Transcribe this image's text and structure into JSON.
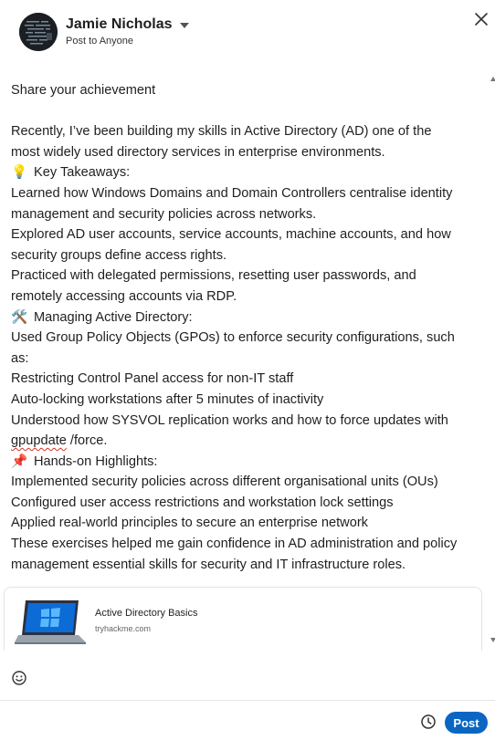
{
  "author": {
    "name": "Jamie Nicholas",
    "audience": "Post to Anyone"
  },
  "editor": {
    "lines": [
      {
        "text": "Share your achievement"
      },
      {
        "text": "",
        "blank": true
      },
      {
        "text": "Recently, I’ve been building my skills in Active Directory (AD) one of the"
      },
      {
        "text": "most widely used directory services in enterprise environments."
      },
      {
        "emoji": "💡",
        "text": "Key Takeaways:"
      },
      {
        "text": "Learned how Windows Domains and Domain Controllers centralise identity"
      },
      {
        "text": "management and security policies across networks."
      },
      {
        "text": "Explored AD user accounts, service accounts, machine accounts, and how"
      },
      {
        "text": "security groups define access rights."
      },
      {
        "text": "Practiced with delegated permissions, resetting user passwords, and"
      },
      {
        "text": "remotely accessing accounts via RDP."
      },
      {
        "emoji": "🛠️",
        "text": "Managing Active Directory:"
      },
      {
        "text": "Used Group Policy Objects (GPOs) to enforce security configurations, such"
      },
      {
        "text": "as:"
      },
      {
        "text": "Restricting Control Panel access for non-IT staff"
      },
      {
        "text": "Auto-locking workstations after 5 minutes of inactivity"
      },
      {
        "text": "Understood how SYSVOL replication works and how to force updates with"
      },
      {
        "squiggle": "gpupdate",
        "text": " /force."
      },
      {
        "emoji": "📌",
        "text": "Hands-on Highlights:"
      },
      {
        "text": "Implemented security policies across different organisational units (OUs)"
      },
      {
        "text": "Configured user access restrictions and workstation lock settings"
      },
      {
        "text": "Applied real-world principles to secure an enterprise network"
      },
      {
        "text": "These exercises helped me gain confidence in AD administration and policy"
      },
      {
        "text": "management essential skills for security and IT infrastructure roles."
      }
    ]
  },
  "preview": {
    "title": "Active Directory Basics",
    "domain": "tryhackme.com"
  },
  "toolbar": {
    "post_label": "Post",
    "post_color": "#0a66c2"
  },
  "icons": {
    "close": "close-icon",
    "emoji": "emoji-icon",
    "schedule": "clock-icon",
    "dropdown": "chevron-down-icon"
  }
}
